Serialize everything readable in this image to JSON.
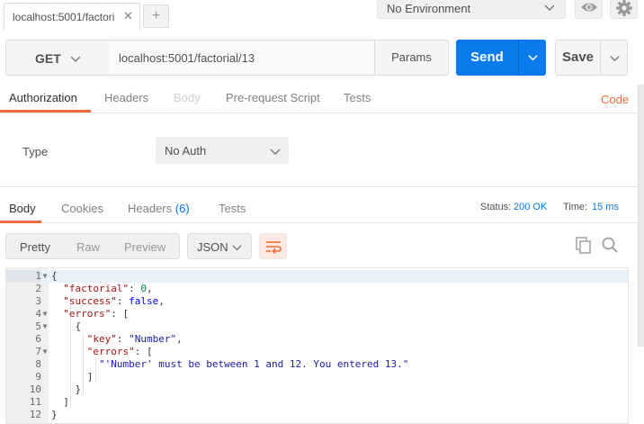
{
  "tabs": {
    "request_tab_label": "localhost:5001/factori",
    "close_glyph": "✕",
    "new_tab_glyph": "+"
  },
  "environment": {
    "selected": "No Environment"
  },
  "request": {
    "method": "GET",
    "url": "localhost:5001/factorial/13",
    "params_label": "Params",
    "send_label": "Send",
    "save_label": "Save"
  },
  "request_tabs": [
    {
      "label": "Authorization",
      "state": "active"
    },
    {
      "label": "Headers",
      "state": "normal"
    },
    {
      "label": "Body",
      "state": "disabled"
    },
    {
      "label": "Pre-request Script",
      "state": "normal"
    },
    {
      "label": "Tests",
      "state": "normal"
    }
  ],
  "code_link": "Code",
  "auth": {
    "type_label": "Type",
    "selected": "No Auth"
  },
  "response_tabs": {
    "body": "Body",
    "cookies": "Cookies",
    "headers": "Headers",
    "headers_count": "(6)",
    "tests": "Tests"
  },
  "status": {
    "label": "Status:",
    "value": "200 OK"
  },
  "time": {
    "label": "Time:",
    "value": "15 ms"
  },
  "view_modes": {
    "pretty": "Pretty",
    "raw": "Raw",
    "preview": "Preview"
  },
  "format": "JSON",
  "code_lines": [
    {
      "n": "1",
      "fold": true,
      "text": "{"
    },
    {
      "n": "2",
      "fold": false,
      "text": "  \"factorial\": 0,"
    },
    {
      "n": "3",
      "fold": false,
      "text": "  \"success\": false,"
    },
    {
      "n": "4",
      "fold": true,
      "text": "  \"errors\": ["
    },
    {
      "n": "5",
      "fold": true,
      "text": "    {"
    },
    {
      "n": "6",
      "fold": false,
      "text": "      \"key\": \"Number\","
    },
    {
      "n": "7",
      "fold": true,
      "text": "      \"errors\": ["
    },
    {
      "n": "8",
      "fold": false,
      "text": "        \"'Number' must be between 1 and 12. You entered 13.\""
    },
    {
      "n": "9",
      "fold": false,
      "text": "      ]"
    },
    {
      "n": "10",
      "fold": false,
      "text": "    }"
    },
    {
      "n": "11",
      "fold": false,
      "text": "  ]"
    },
    {
      "n": "12",
      "fold": false,
      "text": "}"
    }
  ],
  "colors": {
    "accent": "#f26b3a",
    "send_blue": "#097bed",
    "status_blue": "#097bed"
  },
  "icons": [
    "close-icon",
    "plus-icon",
    "chevron-down-icon",
    "eye-icon",
    "gear-icon",
    "wrap-lines-icon",
    "copy-icon",
    "search-icon"
  ]
}
